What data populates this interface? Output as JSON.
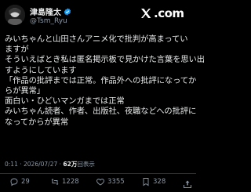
{
  "author": {
    "display_name": "津島隆太",
    "handle": "@Tsm_Ryu"
  },
  "brand": {
    "logo_text": ".com"
  },
  "post": {
    "lines": [
      "みいちゃんと山田さんアニメ化で批判が高まってい",
      "ますが",
      "そういえばとき私は匿名掲示板で見かけた言葉を思い出",
      "すようにしています",
      "「作品の批評までは正常。作品外への批評になってか",
      "らが異常」",
      "面白い・ひどいマンガまでは正常",
      "みいちゃん読者、作者、出版社、夜職などへの批評に",
      "なってからが異常"
    ]
  },
  "meta": {
    "time": "0:11",
    "sep1": "·",
    "date": "2026/07/27",
    "sep2": "·",
    "views": "62万",
    "views_label": "回表示"
  },
  "actions": {
    "reply_count": "29",
    "repost_count": "1228",
    "like_count": "3355",
    "bookmark_count": "328"
  },
  "colors": {
    "background": "#000000",
    "text": "#e7e9ea",
    "muted": "#8b98a5",
    "verified": "#1d9bf0"
  }
}
